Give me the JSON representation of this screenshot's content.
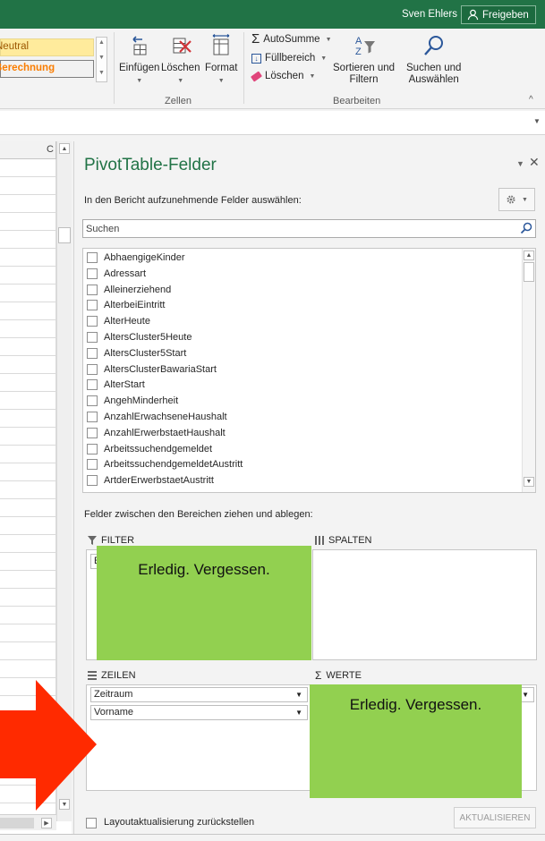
{
  "titlebar": {
    "user": "Sven Ehlers",
    "share_label": "Freigeben"
  },
  "ribbon": {
    "styles": {
      "neutral": "Neutral",
      "calculation": "Berechnung"
    },
    "cells_group": {
      "label": "Zellen",
      "insert": "Einfügen",
      "delete": "Löschen",
      "format": "Format"
    },
    "editing_group": {
      "label": "Bearbeiten",
      "autosum": "AutoSumme",
      "fill": "Füllbereich",
      "clear": "Löschen",
      "sort_filter_line1": "Sortieren und",
      "sort_filter_line2": "Filtern",
      "find_select_line1": "Suchen und",
      "find_select_line2": "Auswählen"
    }
  },
  "sheet": {
    "visible_column": "C"
  },
  "pivot": {
    "title": "PivotTable-Felder",
    "choose_label": "In den Bericht aufzunehmende Felder auswählen:",
    "search_placeholder": "Suchen",
    "fields": [
      "AbhaengigeKinder",
      "Adressart",
      "Alleinerziehend",
      "AlterbeiEintritt",
      "AlterHeute",
      "AltersCluster5Heute",
      "AltersCluster5Start",
      "AltersClusterBawariaStart",
      "AlterStart",
      "AngehMinderheit",
      "AnzahlErwachseneHaushalt",
      "AnzahlErwerbstaetHaushalt",
      "Arbeitssuchendgemeldet",
      "ArbeitssuchendgemeldetAustritt",
      "ArtderErwerbstaetAustritt"
    ],
    "drag_label": "Felder zwischen den Bereichen ziehen und ablegen:",
    "areas": {
      "filter": {
        "label": "FILTER",
        "partial_field": "E"
      },
      "columns": {
        "label": "SPALTEN"
      },
      "rows": {
        "label": "ZEILEN",
        "fields": [
          "Zeitraum",
          "Vorname"
        ]
      },
      "values": {
        "label": "WERTE"
      }
    },
    "defer_label": "Layoutaktualisierung zurückstellen",
    "update_label": "AKTUALISIEREN"
  },
  "annotations": {
    "note_filter": "Erledig. Vergessen.",
    "note_values": "Erledig. Vergessen."
  },
  "colors": {
    "accent": "#217346",
    "note_green": "#92d050",
    "arrow_red": "#ff2a00"
  },
  "icons": [
    "user-icon",
    "insert-cells-icon",
    "delete-cells-icon",
    "format-cells-icon",
    "autosum-icon",
    "fill-icon",
    "eraser-icon",
    "sort-filter-icon",
    "search-icon",
    "gear-icon",
    "close-icon",
    "filter-icon",
    "columns-icon",
    "rows-icon",
    "sigma-icon",
    "arrow"
  ]
}
